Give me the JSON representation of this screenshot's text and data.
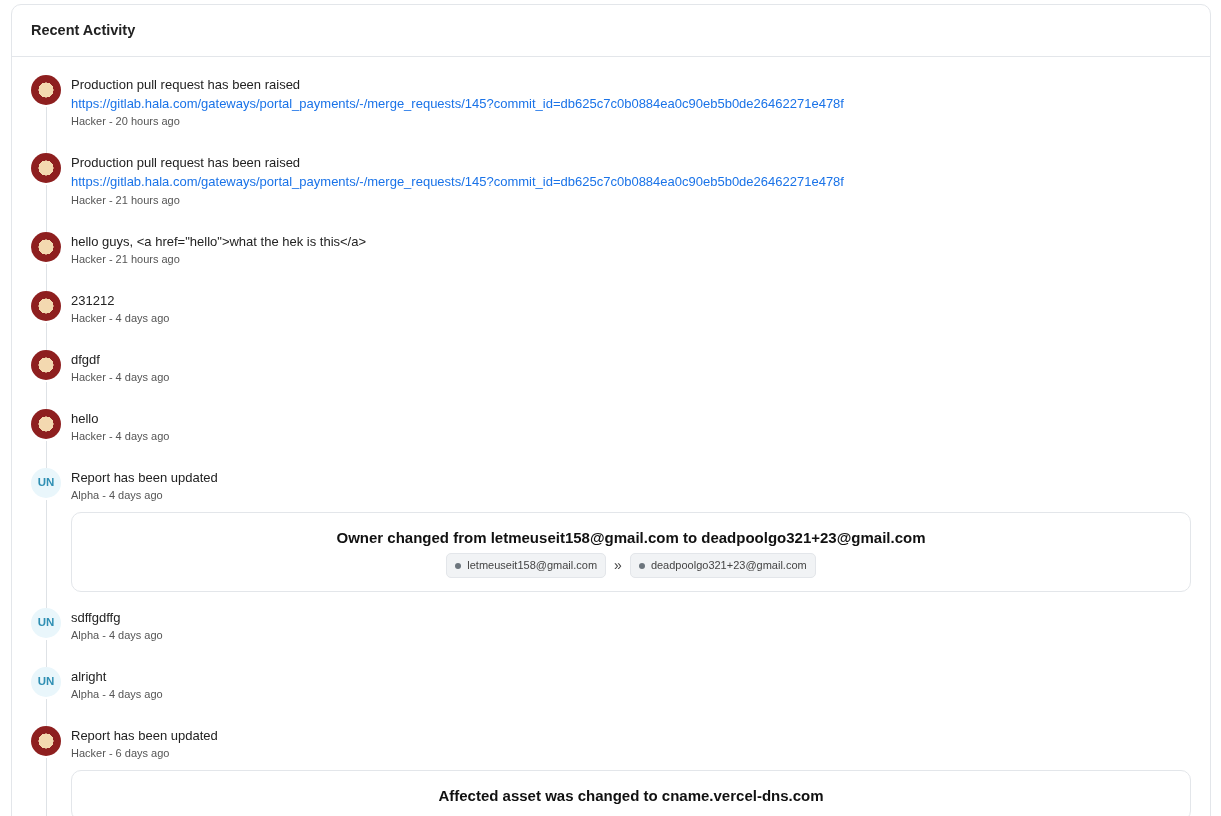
{
  "card": {
    "title": "Recent Activity"
  },
  "entries": [
    {
      "avatar": {
        "kind": "image"
      },
      "message": "Production pull request has been raised",
      "link": "https://gitlab.hala.com/gateways/portal_payments/-/merge_requests/145?commit_id=db625c7c0b0884ea0c90eb5b0de26462271e478f",
      "meta": "Hacker - 20 hours ago"
    },
    {
      "avatar": {
        "kind": "image"
      },
      "message": "Production pull request has been raised",
      "link": "https://gitlab.hala.com/gateways/portal_payments/-/merge_requests/145?commit_id=db625c7c0b0884ea0c90eb5b0de26462271e478f",
      "meta": "Hacker - 21 hours ago"
    },
    {
      "avatar": {
        "kind": "image"
      },
      "message": "hello guys, <a href=\"hello\">what the hek is this</a>",
      "meta": "Hacker - 21 hours ago"
    },
    {
      "avatar": {
        "kind": "image"
      },
      "message": "231212",
      "meta": "Hacker - 4 days ago"
    },
    {
      "avatar": {
        "kind": "image"
      },
      "message": "dfgdf",
      "meta": "Hacker - 4 days ago"
    },
    {
      "avatar": {
        "kind": "image"
      },
      "message": "hello",
      "meta": "Hacker - 4 days ago"
    },
    {
      "avatar": {
        "kind": "initials",
        "text": "UN"
      },
      "message": "Report has been updated",
      "meta": "Alpha - 4 days ago",
      "change": {
        "title": "Owner changed from letmeuseit158@gmail.com to deadpoolgo321+23@gmail.com",
        "from": "letmeuseit158@gmail.com",
        "separator": "»",
        "to": "deadpoolgo321+23@gmail.com"
      }
    },
    {
      "avatar": {
        "kind": "initials",
        "text": "UN"
      },
      "message": "sdffgdffg",
      "meta": "Alpha - 4 days ago"
    },
    {
      "avatar": {
        "kind": "initials",
        "text": "UN"
      },
      "message": "alright",
      "meta": "Alpha - 4 days ago"
    },
    {
      "avatar": {
        "kind": "image"
      },
      "message": "Report has been updated",
      "meta": "Hacker - 6 days ago",
      "change": {
        "title": "Affected asset was changed to cname.vercel-dns.com"
      }
    }
  ]
}
